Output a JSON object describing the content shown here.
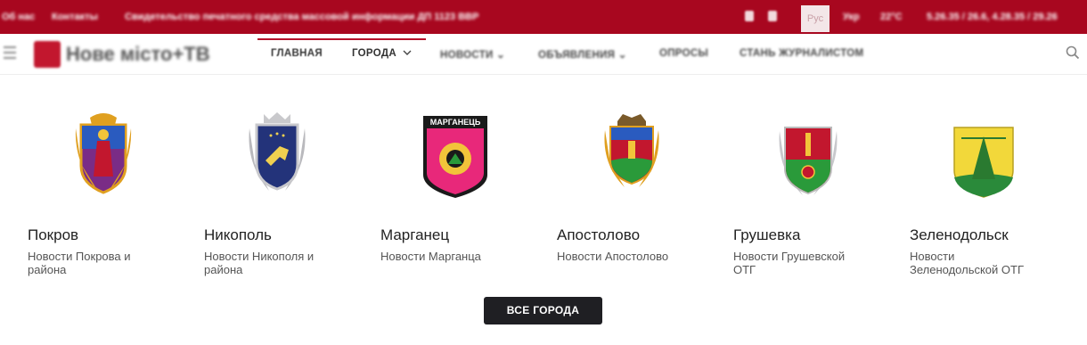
{
  "topbar": {
    "left_links": [
      "Об нас",
      "Контакты"
    ],
    "registration": "Свидетельство печатного средства массовой информации ДП 1123 ВВР",
    "lang": "Рус",
    "lang_alt": "Укр",
    "weather": "22°C",
    "currency": "5.26.35 / 26.6, 4.28.35 / 29.26"
  },
  "header": {
    "logo_text": "Нове місто+ТВ",
    "nav": [
      {
        "label": "ГЛАВНАЯ"
      },
      {
        "label": "ГОРОДА"
      },
      {
        "label": "НОВОСТИ"
      },
      {
        "label": "ОБЪЯВЛЕНИЯ"
      },
      {
        "label": "ОПРОСЫ"
      },
      {
        "label": "СТАНЬ ЖУРНАЛИСТОМ"
      }
    ]
  },
  "cities": [
    {
      "name": "Покров",
      "desc": "Новости Покрова и района"
    },
    {
      "name": "Никополь",
      "desc": "Новости Никополя и района"
    },
    {
      "name": "Марганец",
      "desc": "Новости Марганца",
      "crest_text": "МАРГАНЕЦЬ"
    },
    {
      "name": "Апостолово",
      "desc": "Новости Апостолово"
    },
    {
      "name": "Грушевка",
      "desc": "Новости Грушевской ОТГ"
    },
    {
      "name": "Зеленодольск",
      "desc": "Новости Зеленодольской ОТГ"
    }
  ],
  "all_cities_button": "ВСЕ ГОРОДА",
  "colors": {
    "brand_red": "#a8071f",
    "active_underline": "#b5122a",
    "button_dark": "#1f1f23"
  }
}
